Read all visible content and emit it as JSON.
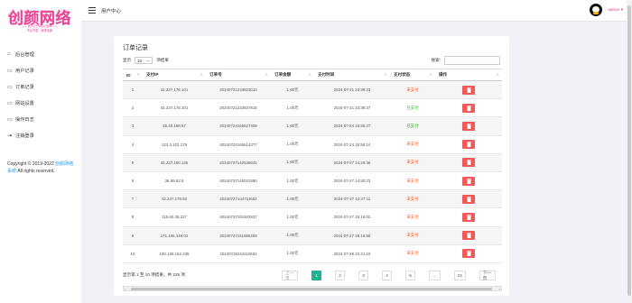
{
  "brand": {
    "logo_text": "创颜网络",
    "logo_sub_1": "—— 我们·只为精心品牌 ——",
    "logo_sub_2": "专业开发 · 值得信赖",
    "pink": "#e84393"
  },
  "header": {
    "title": "用户中心",
    "user_name": "admin ▾"
  },
  "sidebar": {
    "items": [
      {
        "icon": "home-icon",
        "label": "后台管理"
      },
      {
        "icon": "monitor-icon",
        "label": "用户记录"
      },
      {
        "icon": "monitor-icon",
        "label": "订单记录"
      },
      {
        "icon": "monitor-icon",
        "label": "网站设置"
      },
      {
        "icon": "monitor-icon",
        "label": "操作日志"
      },
      {
        "icon": "logout-icon",
        "label": "注销登录"
      }
    ],
    "copyright_prefix": "Copyright © 2019-2022 ",
    "copyright_link": "创颜网络系统",
    "copyright_suffix": " All rights reserved."
  },
  "main": {
    "title": "订单记录",
    "length_prefix": "显示",
    "length_value": "10",
    "length_suffix": "项结果",
    "search_label": "搜索:",
    "columns": [
      "ID",
      "支付IP",
      "订单号",
      "订单金额",
      "支付时间",
      "支付状态",
      "操作"
    ],
    "rows": [
      {
        "id": "1",
        "ip": "42.237.176.101",
        "order": "20240721233823010",
        "amount": "1.00元",
        "time": "2024-07-21 23:38:23",
        "status": "未支付",
        "paid": false
      },
      {
        "id": "2",
        "ip": "42.237.176.101",
        "order": "20240721233837815",
        "amount": "1.00元",
        "time": "2024-07-21 23:38:37",
        "status": "已支付",
        "paid": true
      },
      {
        "id": "3",
        "ip": "36.40.188.67",
        "order": "20240724165527408",
        "amount": "1.00元",
        "time": "2024-07-24 16:55:27",
        "status": "已支付",
        "paid": true
      },
      {
        "id": "4",
        "ip": "123.4.102.179",
        "order": "20240724165614377",
        "amount": "1.00元",
        "time": "2024-07-24 16:56:14",
        "status": "未支付",
        "paid": false
      },
      {
        "id": "5",
        "ip": "42.237.180.135",
        "order": "20240727142536641",
        "amount": "1.00元",
        "time": "2024-07-27 14:25:36",
        "status": "未支付",
        "paid": false
      },
      {
        "id": "6",
        "ip": "36.99.62.9",
        "order": "20240727145023390",
        "amount": "1.00元",
        "time": "2024-07-27 14:50:23",
        "status": "未支付",
        "paid": false
      },
      {
        "id": "7",
        "ip": "42.237.179.50",
        "order": "20240727144711662",
        "amount": "1.00元",
        "time": "2024-07-27 14:47:11",
        "status": "未支付",
        "paid": false
      },
      {
        "id": "8",
        "ip": "115.60.45.227",
        "order": "20240727151602537",
        "amount": "1.00元",
        "time": "2024-07-27 15:16:02",
        "status": "未支付",
        "paid": false
      },
      {
        "id": "9",
        "ip": "171.106.149.02",
        "order": "20240727151655269",
        "amount": "1.00元",
        "time": "2024-07-27 15:16:55",
        "status": "未支付",
        "paid": false
      },
      {
        "id": "10",
        "ip": "180.139.162.235",
        "order": "20240728224110562",
        "amount": "1.00元",
        "time": "2024-07-28 22:41:10",
        "status": "未支付",
        "paid": false
      }
    ],
    "info": "显示第 1 至 10 项结果，共 225 项",
    "pager": {
      "prev": "上一页",
      "pages": [
        "1",
        "2",
        "3",
        "4",
        "5",
        "…",
        "23"
      ],
      "active": "1",
      "next": "下一页"
    }
  },
  "colors": {
    "unpaid": "#ff5722",
    "paid": "#2eb82e",
    "delete_button": "#ef5b5b",
    "active_page": "#1ab394"
  }
}
